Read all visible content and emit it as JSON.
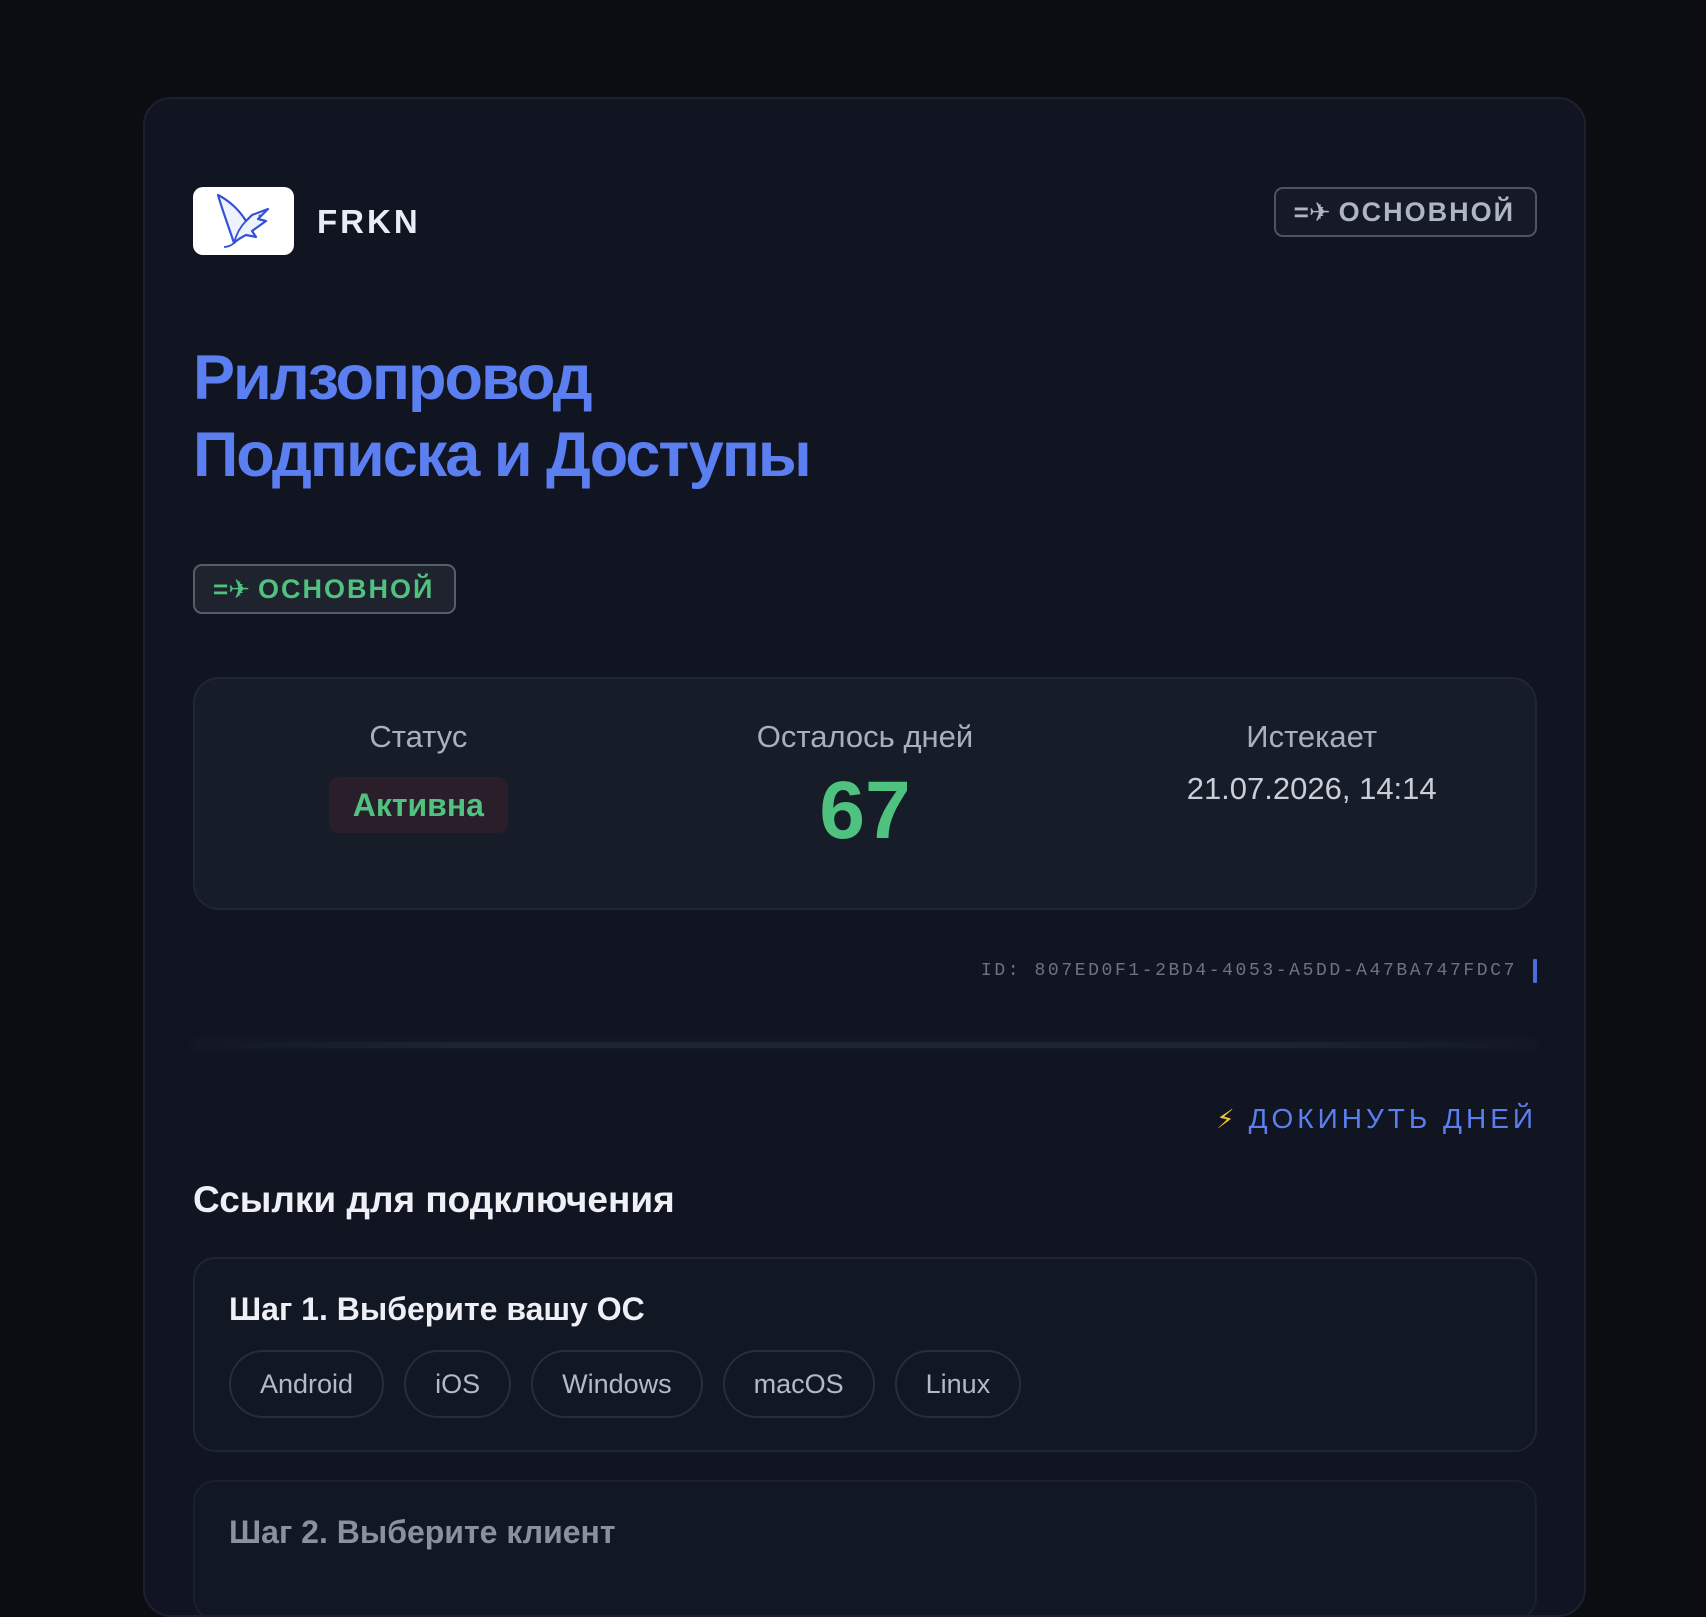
{
  "header": {
    "brand": "FRKN",
    "logo_icon": "pterodactyl-icon",
    "tag_label": "основной",
    "tag_icon": "airplane-icon"
  },
  "title": {
    "line1": "Рилзопровод",
    "line2": "Подписка и Доступы"
  },
  "plan_tag": {
    "label": "основной",
    "icon": "airplane-icon"
  },
  "stats": {
    "status_label": "Статус",
    "status_value": "Активна",
    "days_label": "Осталось дней",
    "days_value": "67",
    "expires_label": "Истекает",
    "expires_value": "21.07.2026, 14:14"
  },
  "subscription": {
    "id_text": "ID: 807ED0F1-2BD4-4053-A5DD-A47BA747FDC7"
  },
  "actions": {
    "extend_label": "докинуть дней",
    "extend_icon": "lightning-icon"
  },
  "links": {
    "section_title": "Ссылки для подключения",
    "step1_title": "Шаг 1. Выберите вашу ОС",
    "os_options": [
      "Android",
      "iOS",
      "Windows",
      "macOS",
      "Linux"
    ],
    "step2_title": "Шаг 2. Выберите клиент"
  },
  "colors": {
    "accent": "#5b7ff1",
    "success": "#4fc27f",
    "bolt": "#f2c23b",
    "background": "#0b0d12",
    "card": "#111521"
  }
}
